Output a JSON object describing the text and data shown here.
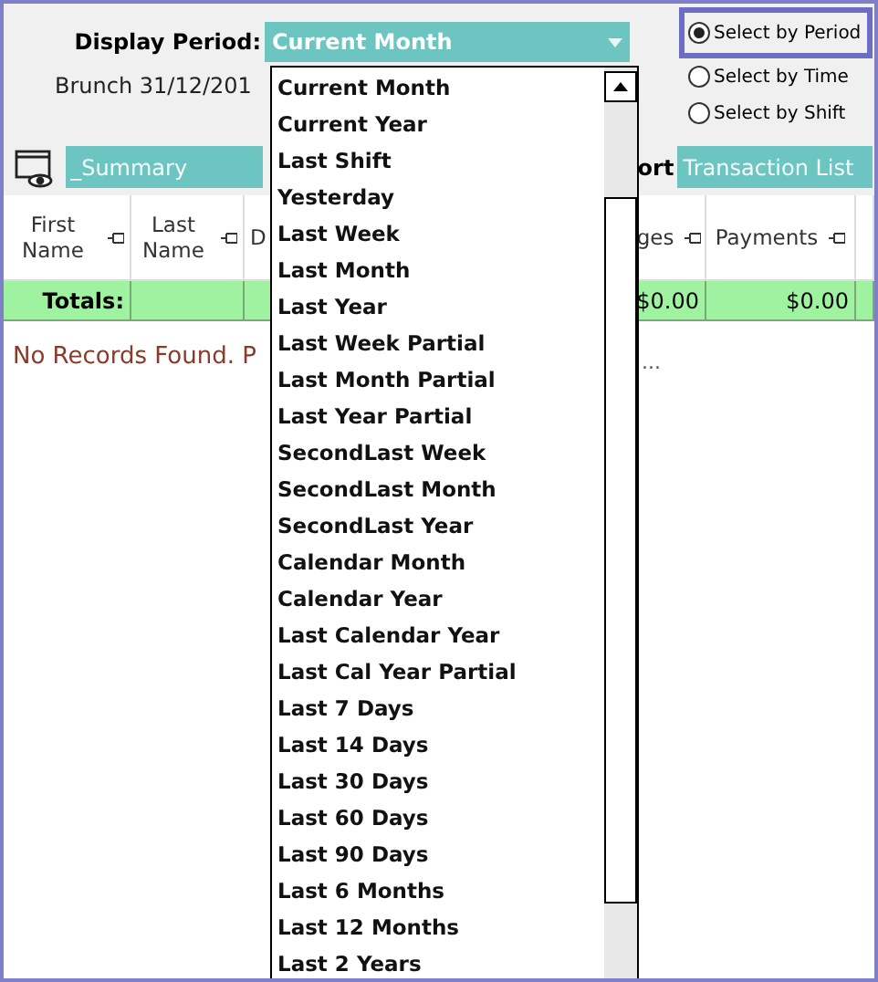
{
  "period": {
    "label": "Display Period:",
    "value": "Current Month"
  },
  "branch_text": "Brunch 31/12/201",
  "modes": [
    {
      "label": "Select by Period",
      "selected": true
    },
    {
      "label": "Select  by Time",
      "selected": false
    },
    {
      "label": "Select by Shift",
      "selected": false
    }
  ],
  "toolbar": {
    "summary": "_Summary",
    "report_label": "ort",
    "report": "Transaction List"
  },
  "table": {
    "columns": [
      "First Name",
      "Last Name",
      "D",
      "ges",
      "Payments"
    ],
    "totals": {
      "label": "Totals:",
      "cells": [
        "$0.00",
        "$0.00"
      ]
    },
    "empty_message": "No Records Found. P",
    "empty_tail": "..."
  },
  "dropdown": {
    "items": [
      {
        "label": "Current Month",
        "selected": false
      },
      {
        "label": "Current Year",
        "selected": false
      },
      {
        "label": "Last Shift",
        "selected": false
      },
      {
        "label": "Yesterday",
        "selected": false
      },
      {
        "label": "Last Week",
        "selected": false
      },
      {
        "label": "Last Month",
        "selected": false
      },
      {
        "label": "Last Year",
        "selected": false
      },
      {
        "label": "Last Week Partial",
        "selected": false
      },
      {
        "label": "Last Month Partial",
        "selected": false
      },
      {
        "label": "Last Year Partial",
        "selected": false
      },
      {
        "label": "SecondLast Week",
        "selected": false
      },
      {
        "label": "SecondLast Month",
        "selected": false
      },
      {
        "label": "SecondLast Year",
        "selected": false
      },
      {
        "label": "Calendar Month",
        "selected": false
      },
      {
        "label": "Calendar Year",
        "selected": false
      },
      {
        "label": "Last Calendar Year",
        "selected": false
      },
      {
        "label": "Last Cal Year Partial",
        "selected": false
      },
      {
        "label": "Last 7 Days",
        "selected": false
      },
      {
        "label": "Last 14 Days",
        "selected": false
      },
      {
        "label": "Last 30 Days",
        "selected": false
      },
      {
        "label": "Last 60 Days",
        "selected": false
      },
      {
        "label": "Last 90 Days",
        "selected": false
      },
      {
        "label": "Last 6 Months",
        "selected": false
      },
      {
        "label": "Last 12 Months",
        "selected": false
      },
      {
        "label": "Last 2 Years",
        "selected": false
      }
    ]
  }
}
